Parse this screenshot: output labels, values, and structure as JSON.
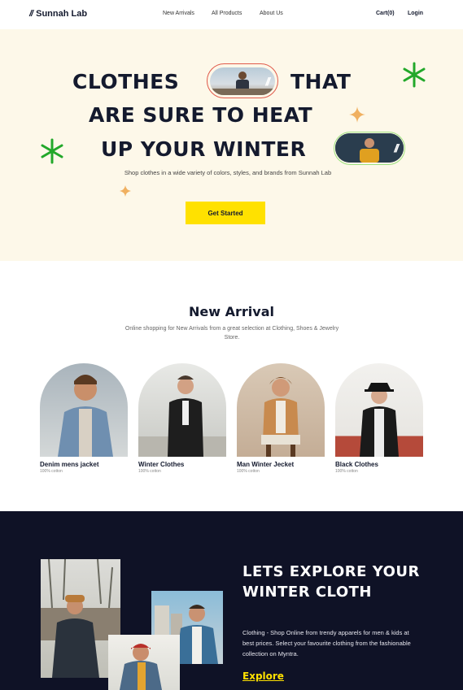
{
  "nav": {
    "logo": "Sunnah Lab",
    "links": [
      "New Arrivals",
      "All Products",
      "About Us"
    ],
    "cart": "Cart(0)",
    "login": "Login"
  },
  "hero": {
    "line1a": "CLOTHES",
    "line1b": "THAT",
    "line2": "ARE SURE TO HEAT",
    "line3": "UP YOUR WINTER",
    "subtitle": "Shop clothes in a wide variety of colors, styles, and brands from Sunnah Lab",
    "cta": "Get Started"
  },
  "new_arrival": {
    "title": "New Arrival",
    "description": "Online shopping for New Arrivals from a great selection at Clothing, Shoes & Jewelry Store.",
    "products": [
      {
        "name": "Denim mens jacket",
        "material": "100% cotton"
      },
      {
        "name": "Winter Clothes",
        "material": "100% cotton"
      },
      {
        "name": "Man Winter Jecket",
        "material": "100% cotton"
      },
      {
        "name": "Black Clothes",
        "material": "100% cotton"
      }
    ]
  },
  "explore": {
    "title": "LETS EXPLORE YOUR WINTER CLOTH",
    "text": "Clothing - Shop Online from trendy apparels for men & kids at best prices. Select your favourite clothing from the fashionable collection on Myntra.",
    "link": "Explore"
  },
  "colors": {
    "accent_yellow": "#ffe100",
    "dark_navy": "#0f1226",
    "hero_bg": "#fdf8e9",
    "sparkle_green": "#22a82a",
    "sparkle_orange": "#f0b060"
  }
}
